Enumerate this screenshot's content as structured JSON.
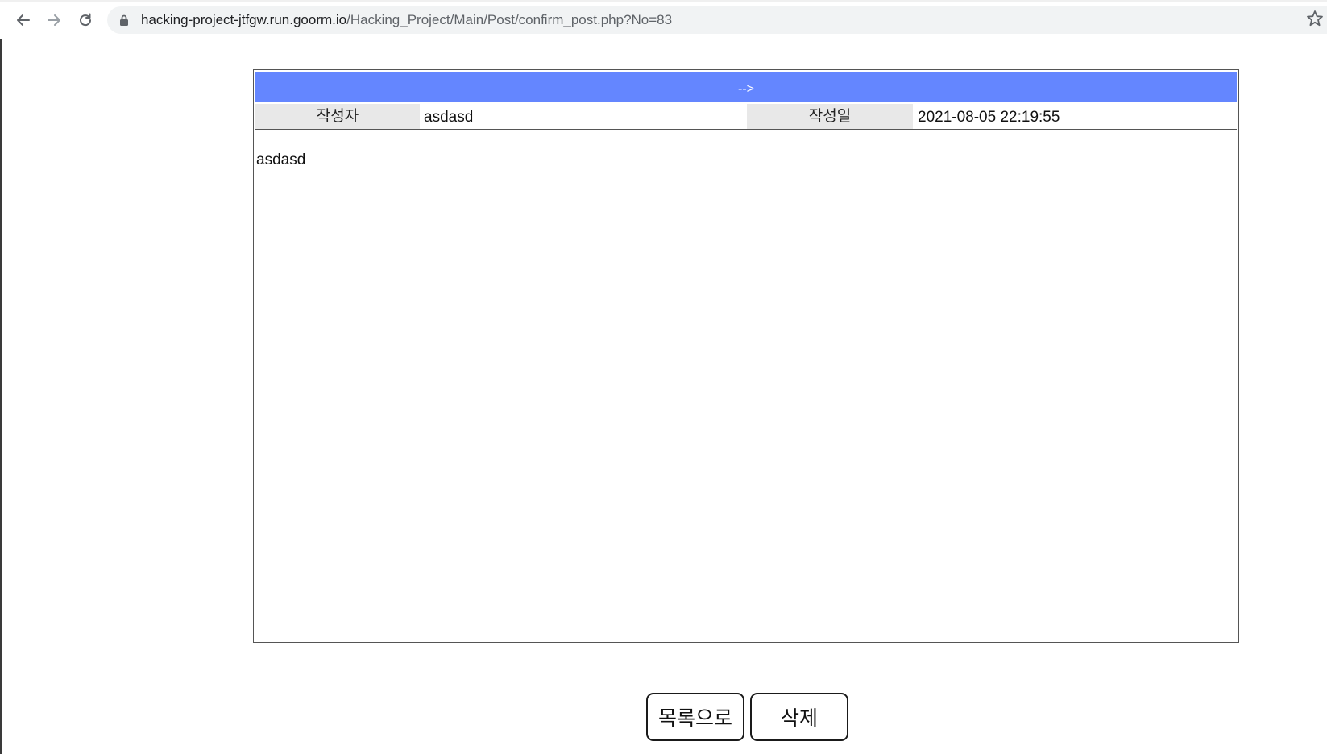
{
  "browser": {
    "url_host": "hacking-project-jtfgw.run.goorm.io",
    "url_path": "/Hacking_Project/Main/Post/confirm_post.php?No=83"
  },
  "post": {
    "title": "-->",
    "author_label": "작성자",
    "author": "asdasd",
    "date_label": "작성일",
    "date": "2021-08-05 22:19:55",
    "body": "asdasd"
  },
  "actions": {
    "list_label": "목록으로",
    "delete_label": "삭제"
  },
  "colors": {
    "title_bar": "#6486ff",
    "label_bg": "#e8e8e8"
  }
}
